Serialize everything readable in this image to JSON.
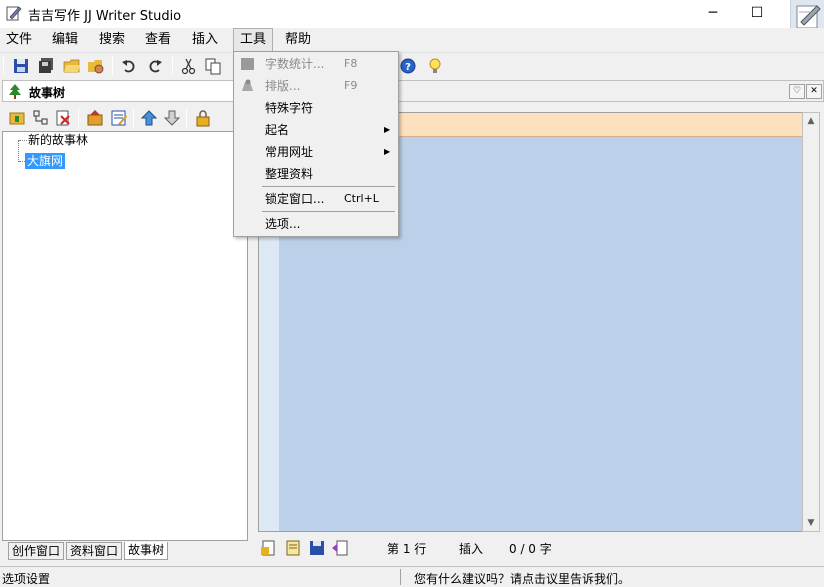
{
  "window": {
    "title": "吉吉写作 JJ Writer Studio",
    "minimize": "─",
    "maximize": "☐"
  },
  "menubar": {
    "items": [
      "文件",
      "编辑",
      "搜索",
      "查看",
      "插入",
      "工具",
      "帮助"
    ],
    "open_item": "工具"
  },
  "tools_menu": {
    "items": [
      {
        "label": "字数统计...",
        "shortcut": "F8",
        "disabled": true,
        "icon": "square-icon"
      },
      {
        "label": "排版...",
        "shortcut": "F9",
        "disabled": true,
        "icon": "format-icon"
      },
      {
        "label": "特殊字符",
        "shortcut": "",
        "disabled": false
      },
      {
        "label": "起名",
        "shortcut": "",
        "disabled": false,
        "submenu": true
      },
      {
        "label": "常用网址",
        "shortcut": "",
        "disabled": false,
        "submenu": true
      },
      {
        "label": "整理资料",
        "shortcut": "",
        "disabled": false
      },
      {
        "label": "锁定窗口...",
        "shortcut": "Ctrl+L",
        "disabled": false
      },
      {
        "label": "选项...",
        "shortcut": "",
        "disabled": false
      }
    ],
    "submenu_arrow": "▶"
  },
  "left_pane": {
    "title": "故事树",
    "tree": {
      "root": "新的故事林",
      "child": "大旗网"
    },
    "tabs": [
      "创作窗口",
      "资料窗口",
      "故事树"
    ],
    "active_tab": "故事树"
  },
  "right_pane": {
    "line_label": "第 1 行",
    "mode_label": "插入",
    "count_label": "0 / 0 字"
  },
  "statusbar": {
    "left": "选项设置",
    "right": "您有什么建议吗？请点击议里告诉我们。"
  },
  "colors": {
    "editor_bg": "#bcd0e9",
    "editor_top": "#fde1bf",
    "selection": "#3399ff"
  }
}
